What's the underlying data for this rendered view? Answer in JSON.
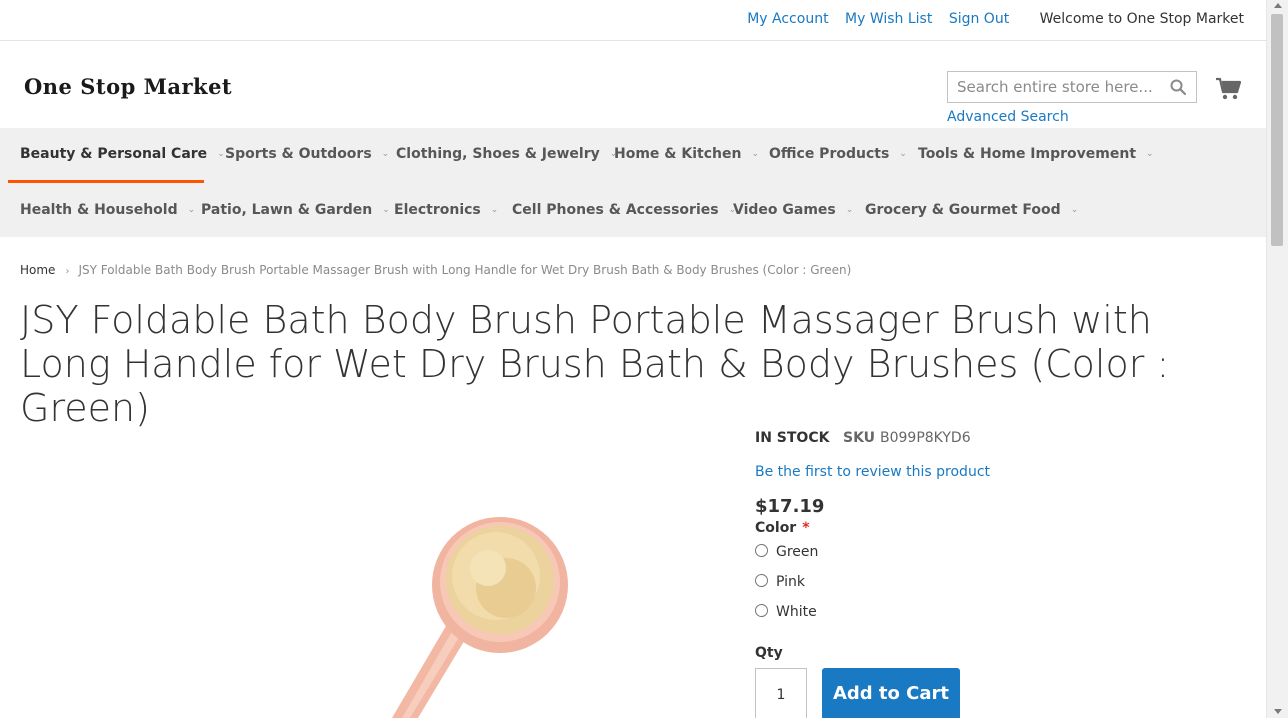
{
  "header": {
    "my_account": "My Account",
    "my_wish_list": "My Wish List",
    "sign_out": "Sign Out",
    "welcome": "Welcome to One Stop Market"
  },
  "logo": {
    "text": "One Stop Market"
  },
  "search": {
    "placeholder": "Search entire store here...",
    "icon": "search-icon",
    "advanced": "Advanced Search"
  },
  "cart": {
    "icon": "shopping-cart-icon"
  },
  "nav": {
    "row1": [
      "Beauty & Personal Care",
      "Sports & Outdoors",
      "Clothing, Shoes & Jewelry",
      "Home & Kitchen",
      "Office Products",
      "Tools & Home Improvement"
    ],
    "row2": [
      "Health & Household",
      "Patio, Lawn & Garden",
      "Electronics",
      "Cell Phones & Accessories",
      "Video Games",
      "Grocery & Gourmet Food"
    ],
    "caret": "⌄",
    "active": "Beauty & Personal Care",
    "accent_color": "#ff5501"
  },
  "breadcrumb": {
    "home": "Home",
    "separator": "›",
    "current": "JSY Foldable Bath Body Brush Portable Massager Brush with Long Handle for Wet Dry Brush Bath & Body Brushes (Color : Green)"
  },
  "product": {
    "title": "JSY Foldable Bath Body Brush Portable Massager Brush with Long Handle for Wet Dry Brush Bath & Body Brushes (Color : Green)",
    "stock": "IN STOCK",
    "sku_label": "SKU",
    "sku": "B099P8KYD6",
    "review_link": "Be the first to review this product",
    "price": "$17.19",
    "color_label": "Color",
    "required_mark": "*",
    "color_options": [
      "Green",
      "Pink",
      "White"
    ],
    "qty_label": "Qty",
    "qty_value": "1",
    "add_to_cart": "Add to Cart",
    "button_color": "#1979c3"
  }
}
